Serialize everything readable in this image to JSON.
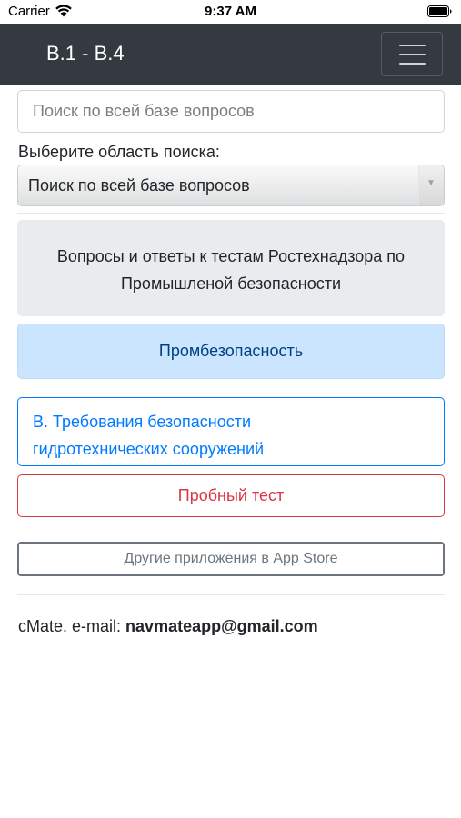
{
  "status_bar": {
    "carrier": "Carrier",
    "time": "9:37 AM",
    "icons": [
      "wifi-icon",
      "battery-icon"
    ]
  },
  "navbar": {
    "brand": "B.1 - B.4",
    "menu_icon": "hamburger-menu-icon",
    "background": "#343a40"
  },
  "search": {
    "placeholder": "Поиск по всей базе вопросов",
    "value": ""
  },
  "scope": {
    "label": "Выберите область поиска:",
    "selected": "Поиск по всей базе вопросов"
  },
  "info_card": {
    "line1": "Вопросы и ответы к тестам Ростехнадзора по",
    "line2": "Промышленой безопасности"
  },
  "section": {
    "label": "Промбезопасность"
  },
  "topic": {
    "line1": "В. Требования безопасности",
    "line2": "гидротехнических сооружений"
  },
  "trial": {
    "label": "Пробный тест"
  },
  "apps": {
    "label": "Другие приложения в App Store"
  },
  "footer": {
    "prefix": "cMate. e-mail:",
    "email": "navmateapp@gmail.com"
  },
  "colors": {
    "primary": "#007bff",
    "danger": "#dc3545",
    "secondary": "#6c757d",
    "alert_bg": "#cce5ff",
    "card_bg": "#e9ecef"
  }
}
